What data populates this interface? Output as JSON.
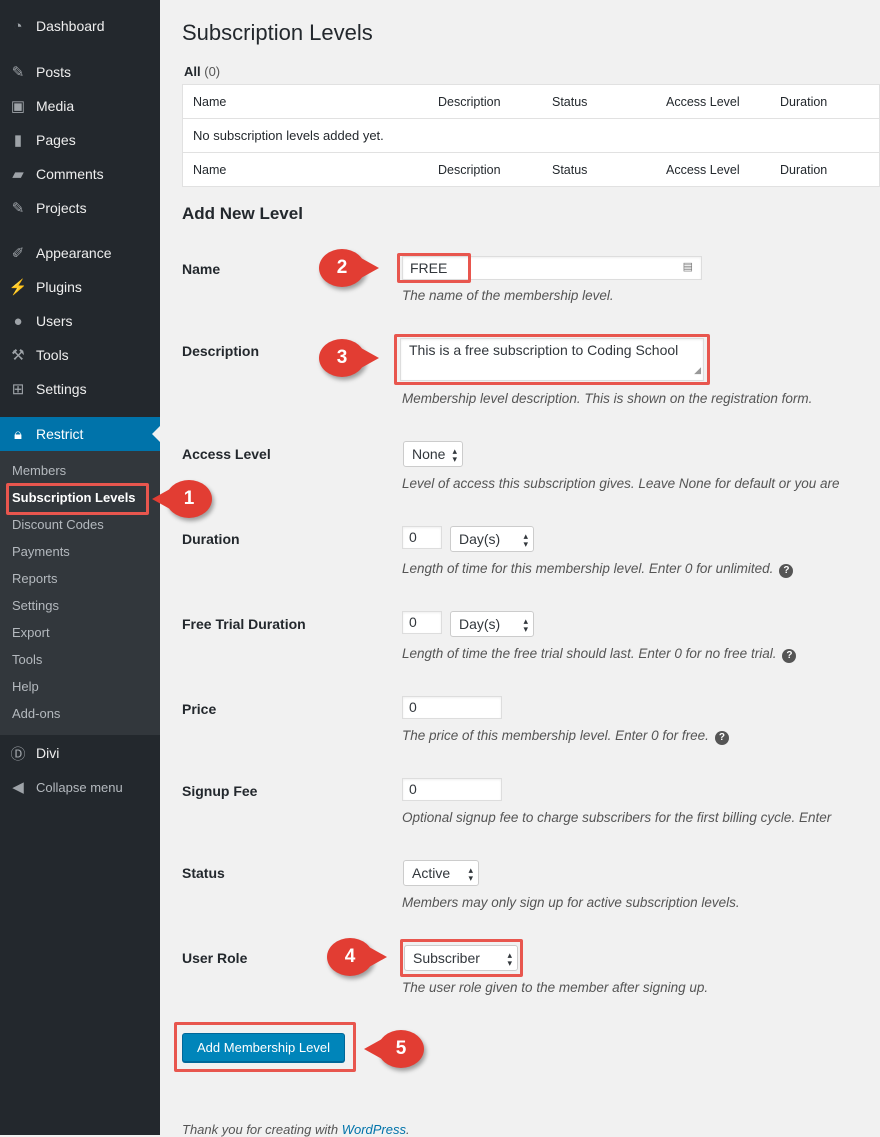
{
  "sidebar": {
    "items": [
      {
        "label": "Dashboard",
        "icon": "dashboard-icon"
      },
      {
        "label": "Posts",
        "icon": "pin-icon"
      },
      {
        "label": "Media",
        "icon": "media-icon"
      },
      {
        "label": "Pages",
        "icon": "pages-icon"
      },
      {
        "label": "Comments",
        "icon": "comment-icon"
      },
      {
        "label": "Projects",
        "icon": "pin-icon"
      },
      {
        "label": "Appearance",
        "icon": "brush-icon"
      },
      {
        "label": "Plugins",
        "icon": "plug-icon"
      },
      {
        "label": "Users",
        "icon": "user-icon"
      },
      {
        "label": "Tools",
        "icon": "wrench-icon"
      },
      {
        "label": "Settings",
        "icon": "settings-icon"
      },
      {
        "label": "Restrict",
        "icon": "lock-icon"
      },
      {
        "label": "Divi",
        "icon": "divi-icon"
      },
      {
        "label": "Collapse menu",
        "icon": "collapse-icon"
      }
    ],
    "submenu": [
      "Members",
      "Subscription Levels",
      "Discount Codes",
      "Payments",
      "Reports",
      "Settings",
      "Export",
      "Tools",
      "Help",
      "Add-ons"
    ]
  },
  "page": {
    "title": "Subscription Levels",
    "filter_all": "All",
    "filter_count": "(0)",
    "columns": [
      "Name",
      "Description",
      "Status",
      "Access Level",
      "Duration"
    ],
    "empty_message": "No subscription levels added yet.",
    "section_title": "Add New Level"
  },
  "form": {
    "name": {
      "label": "Name",
      "value": "FREE",
      "help": "The name of the membership level."
    },
    "description": {
      "label": "Description",
      "value": "This is a free subscription to Coding School",
      "help": "Membership level description. This is shown on the registration form."
    },
    "access_level": {
      "label": "Access Level",
      "value": "None",
      "help": "Level of access this subscription gives. Leave None for default or you are"
    },
    "duration": {
      "label": "Duration",
      "value": "0",
      "unit": "Day(s)",
      "help": "Length of time for this membership level. Enter 0 for unlimited."
    },
    "trial": {
      "label": "Free Trial Duration",
      "value": "0",
      "unit": "Day(s)",
      "help": "Length of time the free trial should last. Enter 0 for no free trial."
    },
    "price": {
      "label": "Price",
      "value": "0",
      "help": "The price of this membership level. Enter 0 for free."
    },
    "signup_fee": {
      "label": "Signup Fee",
      "value": "0",
      "help": "Optional signup fee to charge subscribers for the first billing cycle. Enter"
    },
    "status": {
      "label": "Status",
      "value": "Active",
      "help": "Members may only sign up for active subscription levels."
    },
    "user_role": {
      "label": "User Role",
      "value": "Subscriber",
      "help": "The user role given to the member after signing up."
    },
    "submit": "Add Membership Level"
  },
  "callouts": [
    "1",
    "2",
    "3",
    "4",
    "5"
  ],
  "footer": {
    "text": "Thank you for creating with ",
    "link": "WordPress",
    "end": "."
  },
  "colors": {
    "sidebar": "#23282d",
    "accent": "#0073aa",
    "callout": "#e23d33",
    "button": "#0085ba"
  }
}
